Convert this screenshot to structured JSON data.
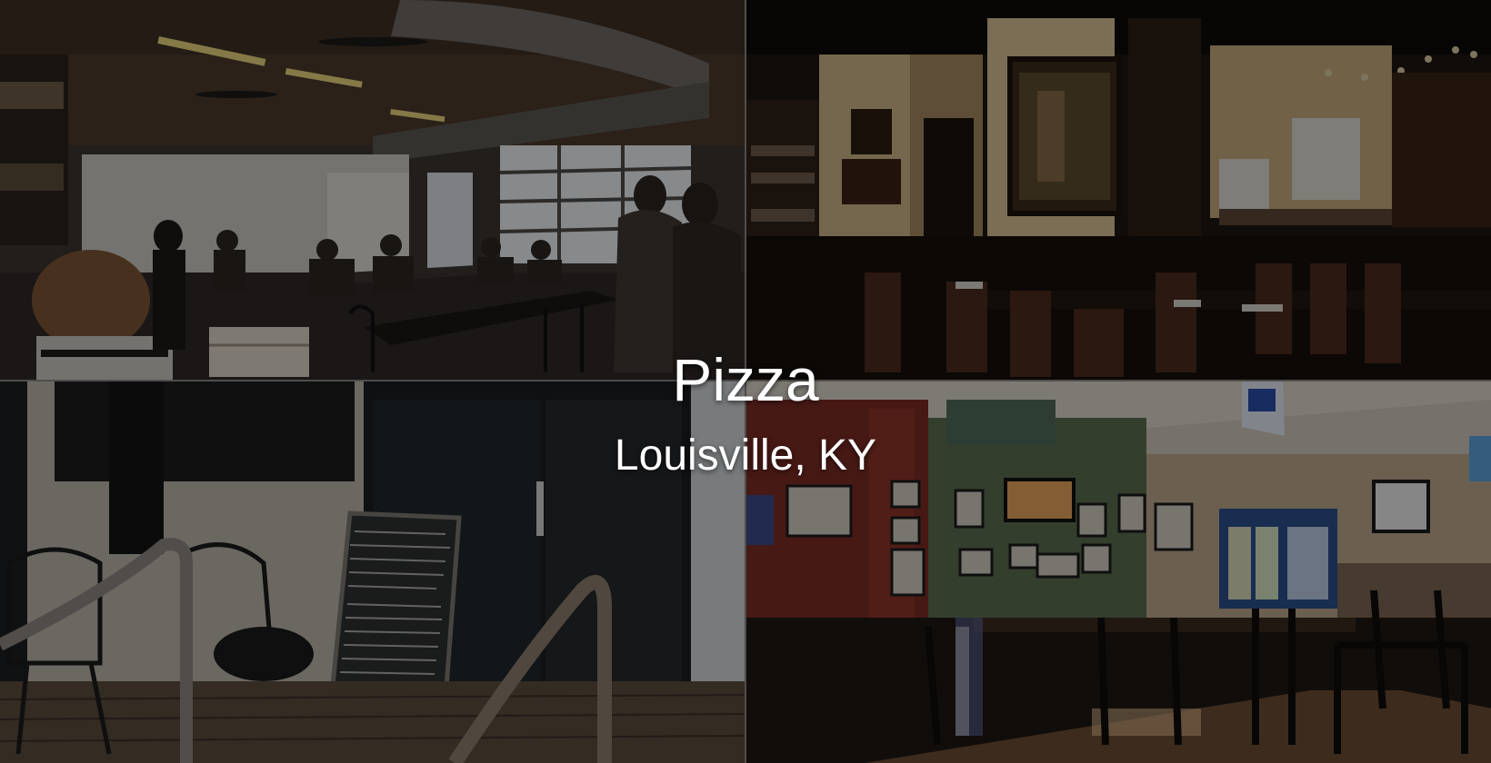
{
  "caption": {
    "title": "Pizza",
    "subtitle": "Louisville, KY"
  },
  "photos": [
    {
      "name": "restaurant-interior-photo"
    },
    {
      "name": "dining-room-bar-photo"
    },
    {
      "name": "patio-chalkboard-photo"
    },
    {
      "name": "sports-bar-dining-photo"
    }
  ],
  "colors": {
    "overlay": "#000000",
    "caption_text": "#ffffff",
    "divider": "#8a8580"
  }
}
